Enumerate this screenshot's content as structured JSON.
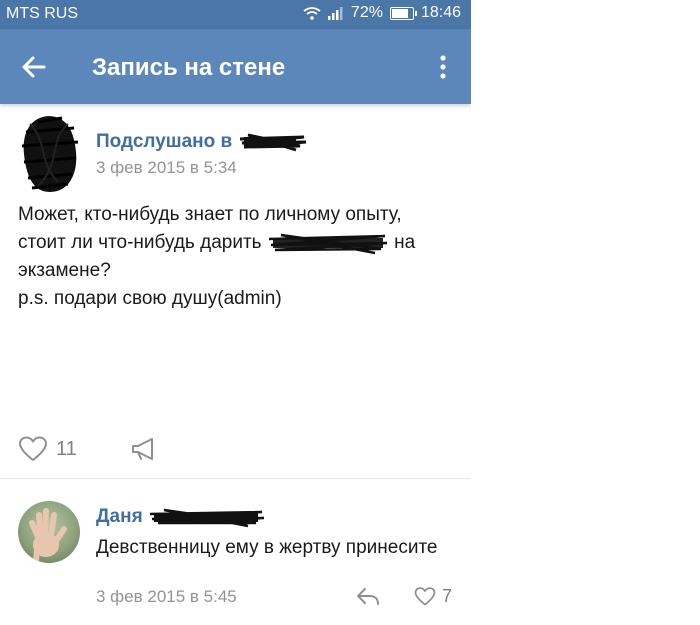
{
  "statusbar": {
    "carrier": "MTS RUS",
    "battery_percent": "72%",
    "time": "18:46",
    "icons": [
      "wifi-icon",
      "signal-icon",
      "battery-icon"
    ]
  },
  "appbar": {
    "title": "Запись на стене",
    "back_icon": "arrow-left-icon",
    "more_icon": "more-vertical-icon"
  },
  "post": {
    "author": "Подслушано в",
    "date": "3 фев 2015 в 5:34",
    "lines": [
      "Может, кто-нибудь знает по личному опыту,",
      "стоит ли что-нибудь дарить",
      "на",
      "экзамене?",
      "p.s. подари свою душу(admin)"
    ],
    "likes": "11"
  },
  "comment": {
    "author": "Даня",
    "text": "Девственницу ему в жертву принесите",
    "date": "3 фев 2015 в 5:45",
    "likes": "7"
  },
  "colors": {
    "statusbar": "#4a76a8",
    "appbar": "#5b87bb",
    "link": "#3f6e9f",
    "meta": "#939393"
  }
}
